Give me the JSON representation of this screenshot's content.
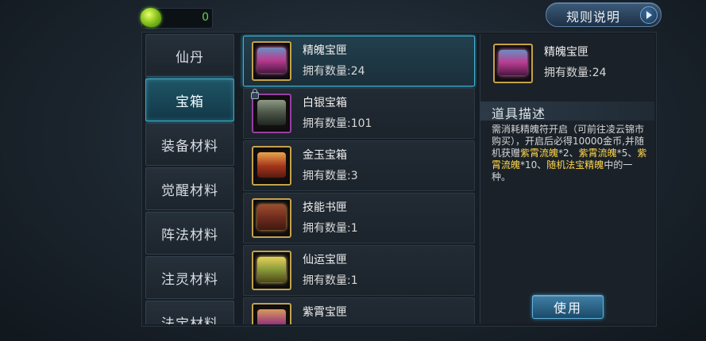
{
  "currency": {
    "value": "0",
    "icon": "green-gem-icon"
  },
  "rules_button": {
    "label": "规则说明"
  },
  "categories": [
    {
      "label": "仙丹",
      "active": false
    },
    {
      "label": "宝箱",
      "active": true
    },
    {
      "label": "装备材料",
      "active": false
    },
    {
      "label": "觉醒材料",
      "active": false
    },
    {
      "label": "阵法材料",
      "active": false
    },
    {
      "label": "注灵材料",
      "active": false
    },
    {
      "label": "法宝材料",
      "active": false
    }
  ],
  "items": [
    {
      "name": "精魄宝匣",
      "count": "拥有数量:24",
      "icon": "pink-treasure-chest-icon",
      "selected": true
    },
    {
      "name": "白银宝箱",
      "count": "拥有数量:101",
      "icon": "silver-chest-icon",
      "locked": true
    },
    {
      "name": "金玉宝箱",
      "count": "拥有数量:3",
      "icon": "gold-chest-icon"
    },
    {
      "name": "技能书匣",
      "count": "拥有数量:1",
      "icon": "skill-book-box-icon"
    },
    {
      "name": "仙运宝匣",
      "count": "拥有数量:1",
      "icon": "fortune-chest-icon"
    },
    {
      "name": "紫霄宝匣",
      "count": "",
      "icon": "purple-chest-icon"
    }
  ],
  "detail": {
    "name": "精魄宝匣",
    "count": "拥有数量:24",
    "icon": "pink-treasure-chest-icon",
    "desc_title": "道具描述",
    "desc_parts": [
      "需消耗精魄符开启（可前往凌云锦市购买），开启后必得10000金币,并随机获赠",
      "紫霄流魄",
      "*2、",
      "紫霄流魄",
      "*5、",
      "紫霄流魄",
      "*10、",
      "随机法宝精魄",
      "中的一种。"
    ]
  },
  "use_button": {
    "label": "使用"
  },
  "colors": {
    "accent": "#3fa8c2",
    "highlight": "#ffd84a",
    "currency": "#67d34a"
  }
}
